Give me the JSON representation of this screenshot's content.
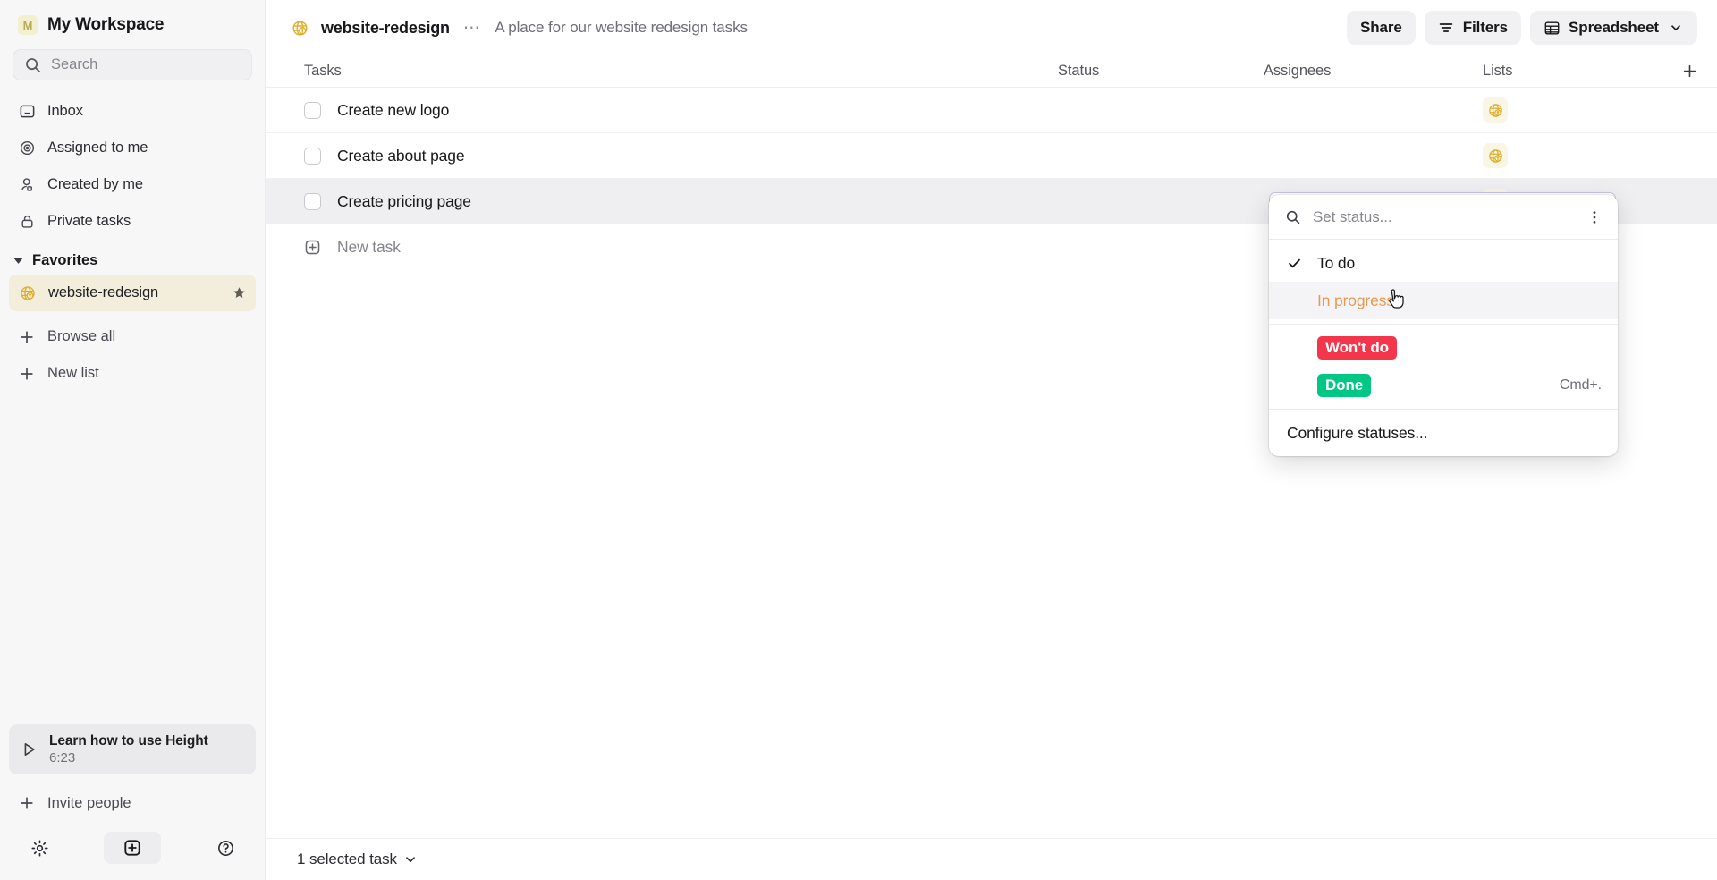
{
  "sidebar": {
    "workspace": {
      "initial": "M",
      "name": "My Workspace"
    },
    "search": {
      "placeholder": "Search"
    },
    "nav": [
      {
        "label": "Inbox",
        "icon": "inbox-icon"
      },
      {
        "label": "Assigned to me",
        "icon": "target-icon"
      },
      {
        "label": "Created by me",
        "icon": "user-icon"
      },
      {
        "label": "Private tasks",
        "icon": "lock-icon"
      }
    ],
    "favorites": {
      "label": "Favorites",
      "items": [
        {
          "label": "website-redesign",
          "icon": "globe-icon",
          "starred": true
        }
      ]
    },
    "actions": [
      {
        "label": "Browse all",
        "icon": "plus-icon"
      },
      {
        "label": "New list",
        "icon": "plus-icon"
      }
    ],
    "promo": {
      "title": "Learn how to use Height",
      "duration": "6:23",
      "icon": "play-icon"
    },
    "invite": {
      "label": "Invite people",
      "icon": "plus-icon"
    },
    "bottom_icons": [
      "gear-icon",
      "new-item-icon",
      "help-icon"
    ]
  },
  "header": {
    "icon": "globe-icon",
    "title": "website-redesign",
    "menu": "⋯",
    "description": "A place for our website redesign tasks",
    "buttons": [
      {
        "label": "Share",
        "icon": ""
      },
      {
        "label": "Filters",
        "icon": "filter-icon"
      },
      {
        "label": "Spreadsheet",
        "icon": "grid-icon",
        "chevron": "˅"
      }
    ]
  },
  "table": {
    "columns": [
      "Tasks",
      "Status",
      "Assignees",
      "Lists"
    ],
    "add_column_icon": "plus-icon",
    "rows": [
      {
        "name": "Create new logo",
        "status": "",
        "assignees": "",
        "list_icon": "globe-icon",
        "selected": false
      },
      {
        "name": "Create about page",
        "status": "",
        "assignees": "",
        "list_icon": "globe-icon",
        "selected": false
      },
      {
        "name": "Create pricing page",
        "status": "",
        "assignees": "",
        "list_icon": "globe-icon",
        "selected": true
      }
    ],
    "new_task_label": "New task"
  },
  "status_popup": {
    "search_placeholder": "Set status...",
    "menu_icon": "kebab-icon",
    "options": [
      {
        "label": "To do",
        "checked": true,
        "style": "plain",
        "shortcut": ""
      },
      {
        "label": "In progress",
        "checked": false,
        "style": "orange-text",
        "shortcut": "",
        "hovered": true
      },
      {
        "label": "Won't do",
        "checked": false,
        "style": "badge",
        "color": "#F4364C",
        "shortcut": ""
      },
      {
        "label": "Done",
        "checked": false,
        "style": "badge",
        "color": "#01C784",
        "shortcut": "Cmd+."
      }
    ],
    "footer": {
      "label": "Configure statuses..."
    }
  },
  "statusbar": {
    "selection": "1 selected task",
    "chevron": "˅"
  },
  "colors": {
    "accent_gold": "#E0AE2A",
    "selected_row": "#EFEFF1",
    "favorite_bg": "#F3EEDB",
    "active_cell_border": "#C9C2E8",
    "orange": "#EA9A4C",
    "red": "#F4364C",
    "green": "#01C784"
  }
}
